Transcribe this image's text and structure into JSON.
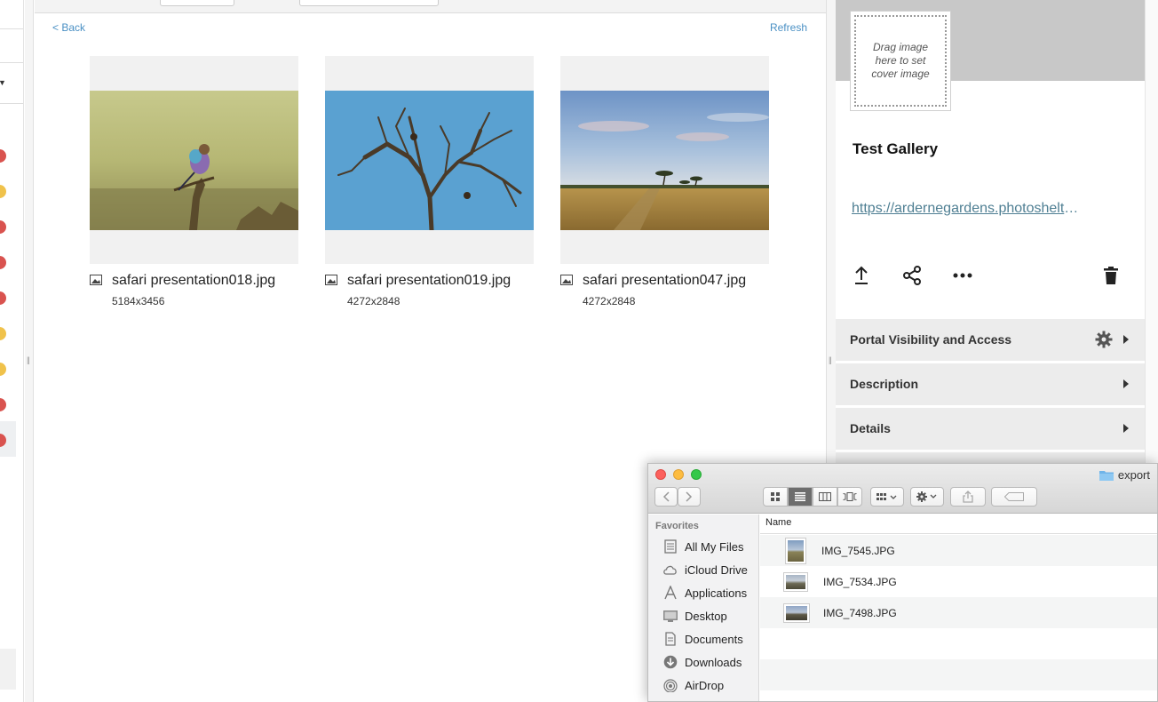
{
  "content": {
    "back_label": "< Back",
    "refresh_label": "Refresh",
    "images": [
      {
        "name": "safari presentation018.jpg",
        "dims": "5184x3456"
      },
      {
        "name": "safari presentation019.jpg",
        "dims": "4272x2848"
      },
      {
        "name": "safari presentation047.jpg",
        "dims": "4272x2848"
      }
    ]
  },
  "panel": {
    "cover_hint": "Drag image here to set cover image",
    "title": "Test Gallery",
    "url": "https://ardernegardens.photoshelter.com",
    "sections": [
      {
        "label": "Portal Visibility and Access"
      },
      {
        "label": "Description"
      },
      {
        "label": "Details"
      }
    ]
  },
  "finder": {
    "title": "export",
    "sidebar_heading": "Favorites",
    "favorites": [
      {
        "label": "All My Files",
        "icon": "all-files-icon"
      },
      {
        "label": "iCloud Drive",
        "icon": "cloud-icon"
      },
      {
        "label": "Applications",
        "icon": "applications-icon"
      },
      {
        "label": "Desktop",
        "icon": "desktop-icon"
      },
      {
        "label": "Documents",
        "icon": "documents-icon"
      },
      {
        "label": "Downloads",
        "icon": "downloads-icon"
      },
      {
        "label": "AirDrop",
        "icon": "airdrop-icon"
      }
    ],
    "column_name": "Name",
    "files": [
      {
        "name": "IMG_7545.JPG"
      },
      {
        "name": "IMG_7534.JPG"
      },
      {
        "name": "IMG_7498.JPG"
      }
    ]
  },
  "colors": {
    "link": "#4a90c4",
    "url": "#4f7f93",
    "section_bg": "#ececec",
    "cover_band": "#c8c8c8"
  }
}
